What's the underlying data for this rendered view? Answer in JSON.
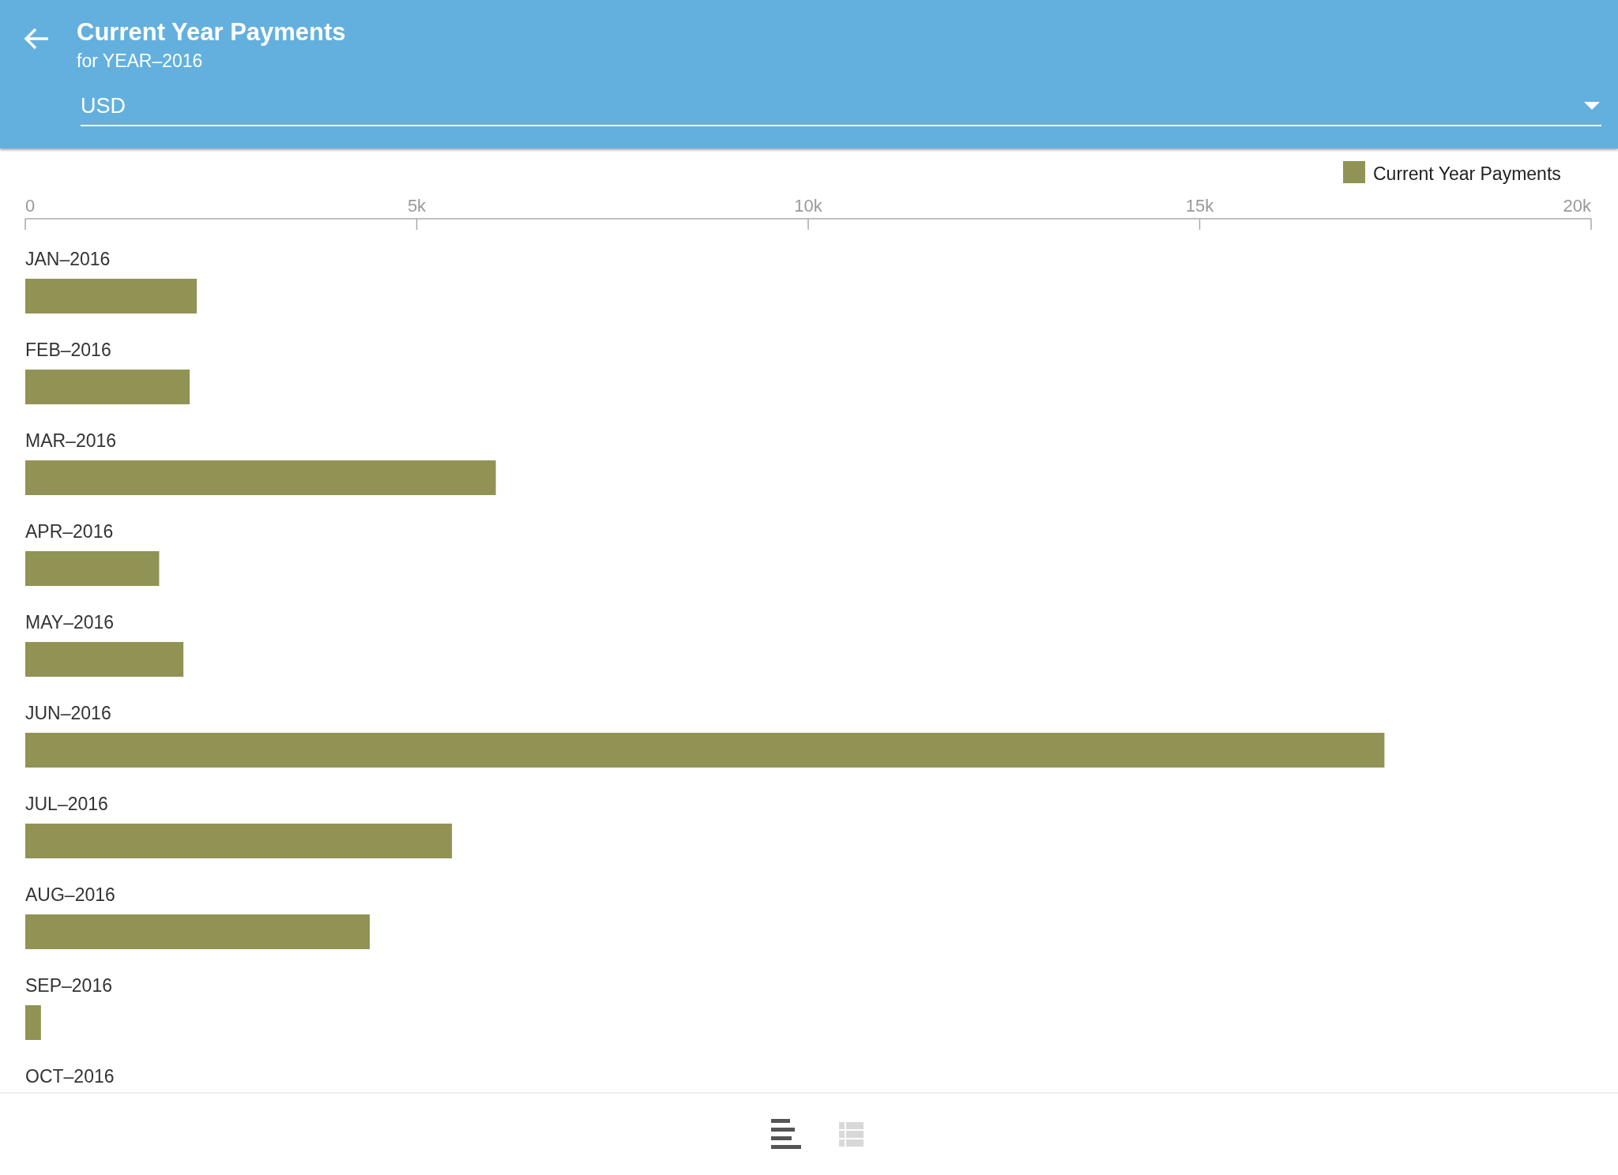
{
  "app_bar": {
    "title": "Current Year Payments",
    "subtitle": "for YEAR–2016",
    "currency": "USD"
  },
  "chart": {
    "chart_data": {
      "type": "bar",
      "orientation": "horizontal",
      "categories": [
        "JAN–2016",
        "FEB–2016",
        "MAR–2016",
        "APR–2016",
        "MAY–2016",
        "JUN–2016",
        "JUL–2016",
        "AUG–2016",
        "SEP–2016",
        "OCT–2016"
      ],
      "series": [
        {
          "name": "Current Year Payments",
          "color": "#909354",
          "values": [
            2190,
            2100,
            6010,
            1710,
            2020,
            17360,
            5450,
            4400,
            200,
            null
          ]
        }
      ],
      "xlim": [
        0,
        20000
      ],
      "xticks": [
        {
          "value": 0,
          "label": "0"
        },
        {
          "value": 5000,
          "label": "5k"
        },
        {
          "value": 10000,
          "label": "10k"
        },
        {
          "value": 15000,
          "label": "15k"
        },
        {
          "value": 20000,
          "label": "20k"
        }
      ]
    }
  },
  "bottom_nav": [
    {
      "kind": "chart",
      "selected": true
    },
    {
      "kind": "table",
      "selected": false
    }
  ]
}
